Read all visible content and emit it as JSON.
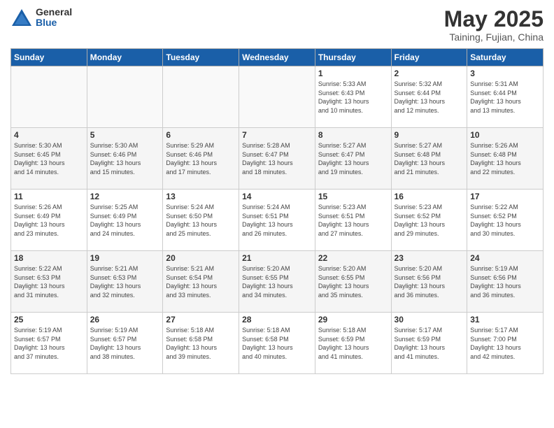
{
  "logo": {
    "general": "General",
    "blue": "Blue"
  },
  "title": "May 2025",
  "subtitle": "Taining, Fujian, China",
  "days_header": [
    "Sunday",
    "Monday",
    "Tuesday",
    "Wednesday",
    "Thursday",
    "Friday",
    "Saturday"
  ],
  "weeks": [
    [
      {
        "num": "",
        "info": ""
      },
      {
        "num": "",
        "info": ""
      },
      {
        "num": "",
        "info": ""
      },
      {
        "num": "",
        "info": ""
      },
      {
        "num": "1",
        "info": "Sunrise: 5:33 AM\nSunset: 6:43 PM\nDaylight: 13 hours\nand 10 minutes."
      },
      {
        "num": "2",
        "info": "Sunrise: 5:32 AM\nSunset: 6:44 PM\nDaylight: 13 hours\nand 12 minutes."
      },
      {
        "num": "3",
        "info": "Sunrise: 5:31 AM\nSunset: 6:44 PM\nDaylight: 13 hours\nand 13 minutes."
      }
    ],
    [
      {
        "num": "4",
        "info": "Sunrise: 5:30 AM\nSunset: 6:45 PM\nDaylight: 13 hours\nand 14 minutes."
      },
      {
        "num": "5",
        "info": "Sunrise: 5:30 AM\nSunset: 6:46 PM\nDaylight: 13 hours\nand 15 minutes."
      },
      {
        "num": "6",
        "info": "Sunrise: 5:29 AM\nSunset: 6:46 PM\nDaylight: 13 hours\nand 17 minutes."
      },
      {
        "num": "7",
        "info": "Sunrise: 5:28 AM\nSunset: 6:47 PM\nDaylight: 13 hours\nand 18 minutes."
      },
      {
        "num": "8",
        "info": "Sunrise: 5:27 AM\nSunset: 6:47 PM\nDaylight: 13 hours\nand 19 minutes."
      },
      {
        "num": "9",
        "info": "Sunrise: 5:27 AM\nSunset: 6:48 PM\nDaylight: 13 hours\nand 21 minutes."
      },
      {
        "num": "10",
        "info": "Sunrise: 5:26 AM\nSunset: 6:48 PM\nDaylight: 13 hours\nand 22 minutes."
      }
    ],
    [
      {
        "num": "11",
        "info": "Sunrise: 5:26 AM\nSunset: 6:49 PM\nDaylight: 13 hours\nand 23 minutes."
      },
      {
        "num": "12",
        "info": "Sunrise: 5:25 AM\nSunset: 6:49 PM\nDaylight: 13 hours\nand 24 minutes."
      },
      {
        "num": "13",
        "info": "Sunrise: 5:24 AM\nSunset: 6:50 PM\nDaylight: 13 hours\nand 25 minutes."
      },
      {
        "num": "14",
        "info": "Sunrise: 5:24 AM\nSunset: 6:51 PM\nDaylight: 13 hours\nand 26 minutes."
      },
      {
        "num": "15",
        "info": "Sunrise: 5:23 AM\nSunset: 6:51 PM\nDaylight: 13 hours\nand 27 minutes."
      },
      {
        "num": "16",
        "info": "Sunrise: 5:23 AM\nSunset: 6:52 PM\nDaylight: 13 hours\nand 29 minutes."
      },
      {
        "num": "17",
        "info": "Sunrise: 5:22 AM\nSunset: 6:52 PM\nDaylight: 13 hours\nand 30 minutes."
      }
    ],
    [
      {
        "num": "18",
        "info": "Sunrise: 5:22 AM\nSunset: 6:53 PM\nDaylight: 13 hours\nand 31 minutes."
      },
      {
        "num": "19",
        "info": "Sunrise: 5:21 AM\nSunset: 6:53 PM\nDaylight: 13 hours\nand 32 minutes."
      },
      {
        "num": "20",
        "info": "Sunrise: 5:21 AM\nSunset: 6:54 PM\nDaylight: 13 hours\nand 33 minutes."
      },
      {
        "num": "21",
        "info": "Sunrise: 5:20 AM\nSunset: 6:55 PM\nDaylight: 13 hours\nand 34 minutes."
      },
      {
        "num": "22",
        "info": "Sunrise: 5:20 AM\nSunset: 6:55 PM\nDaylight: 13 hours\nand 35 minutes."
      },
      {
        "num": "23",
        "info": "Sunrise: 5:20 AM\nSunset: 6:56 PM\nDaylight: 13 hours\nand 36 minutes."
      },
      {
        "num": "24",
        "info": "Sunrise: 5:19 AM\nSunset: 6:56 PM\nDaylight: 13 hours\nand 36 minutes."
      }
    ],
    [
      {
        "num": "25",
        "info": "Sunrise: 5:19 AM\nSunset: 6:57 PM\nDaylight: 13 hours\nand 37 minutes."
      },
      {
        "num": "26",
        "info": "Sunrise: 5:19 AM\nSunset: 6:57 PM\nDaylight: 13 hours\nand 38 minutes."
      },
      {
        "num": "27",
        "info": "Sunrise: 5:18 AM\nSunset: 6:58 PM\nDaylight: 13 hours\nand 39 minutes."
      },
      {
        "num": "28",
        "info": "Sunrise: 5:18 AM\nSunset: 6:58 PM\nDaylight: 13 hours\nand 40 minutes."
      },
      {
        "num": "29",
        "info": "Sunrise: 5:18 AM\nSunset: 6:59 PM\nDaylight: 13 hours\nand 41 minutes."
      },
      {
        "num": "30",
        "info": "Sunrise: 5:17 AM\nSunset: 6:59 PM\nDaylight: 13 hours\nand 41 minutes."
      },
      {
        "num": "31",
        "info": "Sunrise: 5:17 AM\nSunset: 7:00 PM\nDaylight: 13 hours\nand 42 minutes."
      }
    ]
  ]
}
